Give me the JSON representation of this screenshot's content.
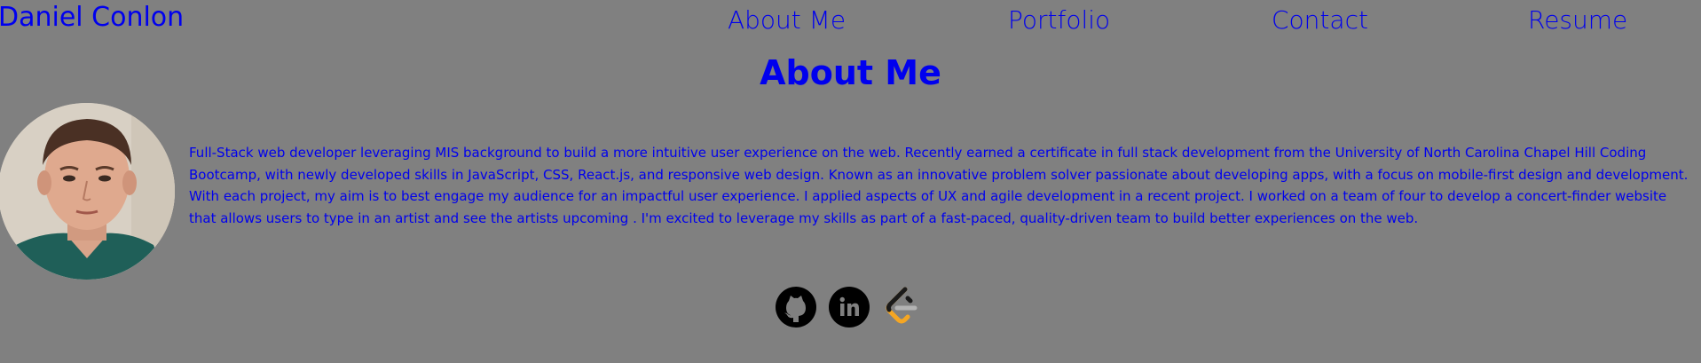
{
  "header": {
    "site_title": "Daniel Conlon",
    "nav": [
      {
        "label": "About Me"
      },
      {
        "label": "Portfolio"
      },
      {
        "label": "Contact"
      },
      {
        "label": "Resume"
      }
    ]
  },
  "main": {
    "heading": "About Me",
    "bio": "Full-Stack web developer leveraging MIS background to build a more intuitive user experience on the web. Recently earned a certificate in full stack development from the University of North Carolina Chapel Hill Coding Bootcamp, with newly developed skills in JavaScript, CSS, React.js, and responsive web design. Known as an innovative problem solver passionate about developing apps, with a focus on mobile-first design and development. With each project, my aim is to best engage my audience for an impactful user experience. I applied aspects of UX and agile development in a recent project. I worked on a team of four to develop a concert-finder website that allows users to type in an artist and see the artists upcoming . I'm excited to leverage my skills as part of a fast-paced, quality-driven team to build better experiences on the web.",
    "social_icons": [
      "github-icon",
      "linkedin-icon",
      "leetcode-icon"
    ]
  },
  "colors": {
    "background": "#808080",
    "link": "#0000ee"
  }
}
